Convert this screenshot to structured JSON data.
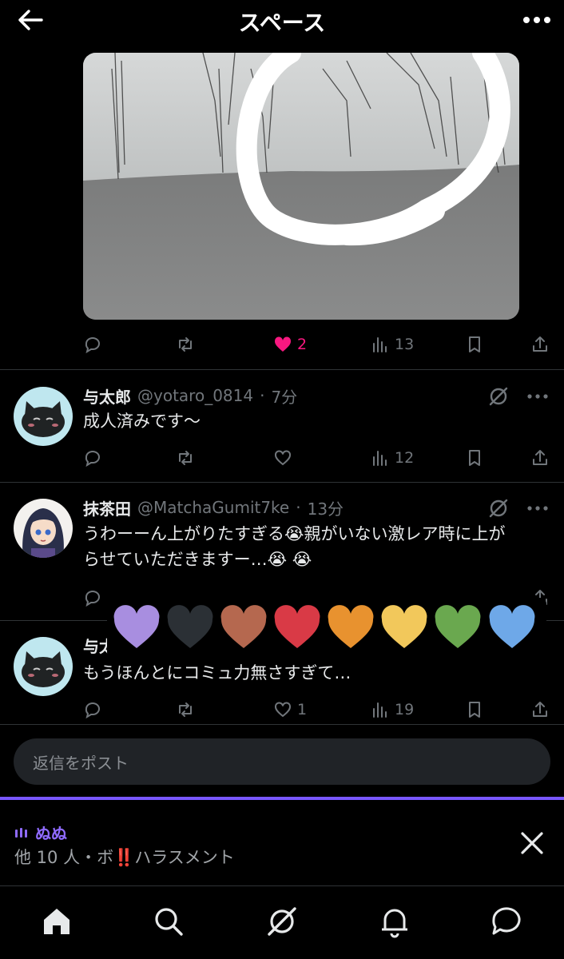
{
  "header": {
    "title": "スペース"
  },
  "top_post": {
    "likes": "2",
    "views": "13"
  },
  "posts": [
    {
      "name": "与太郎",
      "handle": "@yotaro_0814",
      "time": "7分",
      "text": "成人済みです〜",
      "likes": "",
      "views": "12"
    },
    {
      "name": "抹茶田",
      "handle": "@MatchaGumit7ke",
      "time": "13分",
      "text_line1": "うわーーん上がりたすぎる😭親がいない激レア時に上が",
      "text_line2": "らせていただきますー…😭 😭"
    },
    {
      "name": "与太",
      "text": "もうほんとにコミュ力無さすぎて…",
      "likes": "1",
      "views": "19"
    }
  ],
  "reaction_colors": [
    "#a88ee0",
    "#2b3035",
    "#b5684f",
    "#d93a46",
    "#e8922f",
    "#f2c85b",
    "#6aa84f",
    "#6ea8e8"
  ],
  "reply": {
    "placeholder": "返信をポスト"
  },
  "space": {
    "host": "ぬぬ",
    "info": "他 10 人・ボ‼️ハラスメント"
  },
  "tabs": [
    "home-icon",
    "search-icon",
    "grok-icon",
    "notifications-icon",
    "messages-icon"
  ],
  "colors": {
    "accent": "#7856ff",
    "like": "#f91880",
    "muted": "#71767b"
  }
}
